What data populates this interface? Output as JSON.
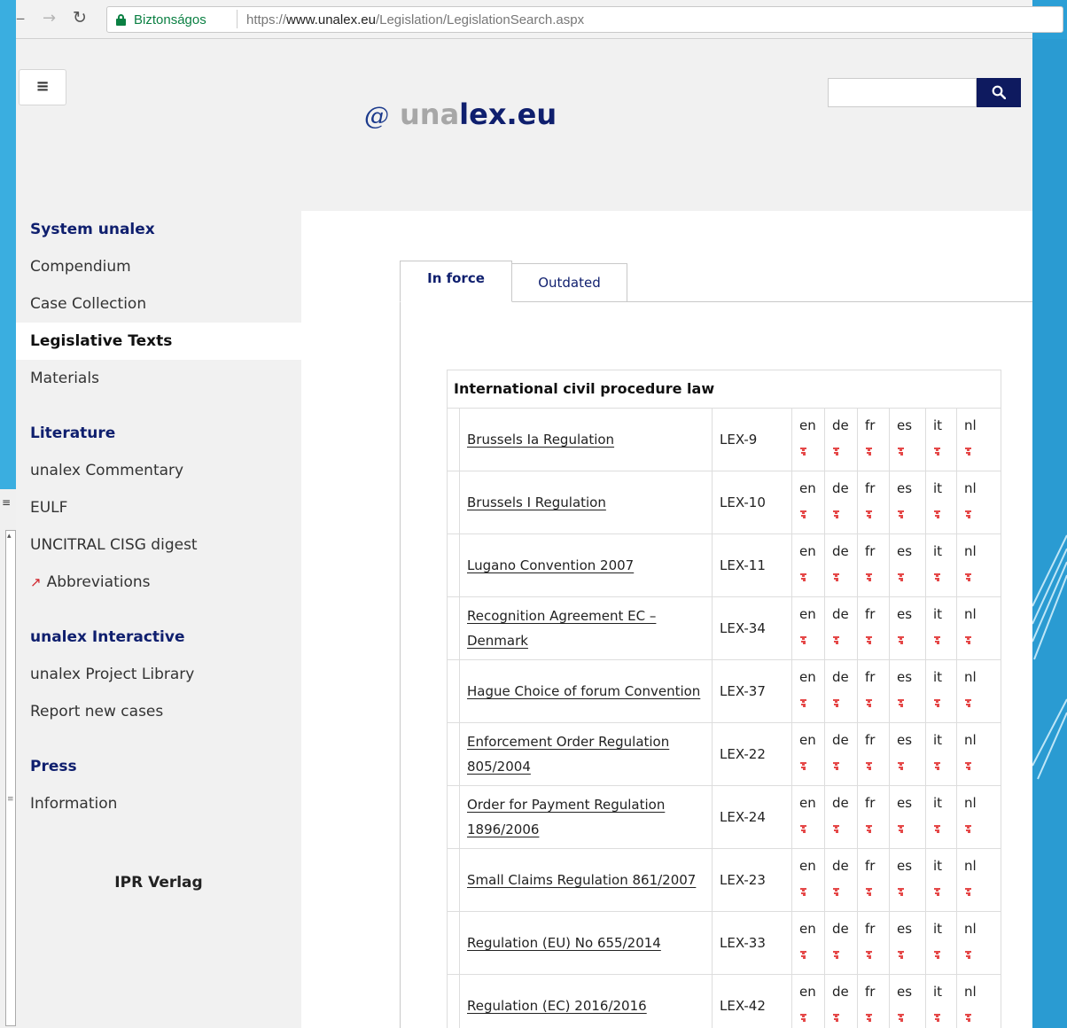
{
  "browser": {
    "secure_label": "Biztonságos",
    "url_scheme": "https://",
    "url_host": "www.unalex.eu",
    "url_path": "/Legislation/LegislationSearch.aspx"
  },
  "header": {
    "menu_icon": "≡",
    "logo_at": "@",
    "logo_una": "una",
    "logo_lex": "lex.eu",
    "search_placeholder": ""
  },
  "sidebar": {
    "items": [
      {
        "label": "System unalex",
        "kind": "head"
      },
      {
        "label": "Compendium"
      },
      {
        "label": "Case Collection"
      },
      {
        "label": "Legislative Texts",
        "kind": "active"
      },
      {
        "label": "Materials"
      },
      {
        "label": "Literature",
        "kind": "head"
      },
      {
        "label": "unalex Commentary"
      },
      {
        "label": "EULF"
      },
      {
        "label": "UNCITRAL CISG digest"
      },
      {
        "label": "Abbreviations",
        "external_icon": "↗"
      },
      {
        "label": "unalex Interactive",
        "kind": "head"
      },
      {
        "label": "unalex Project Library"
      },
      {
        "label": "Report new cases"
      },
      {
        "label": "Press",
        "kind": "head"
      },
      {
        "label": "Information"
      }
    ],
    "footer": "IPR Verlag"
  },
  "tabs": {
    "in_force": "In force",
    "outdated": "Outdated"
  },
  "table": {
    "caption": "International civil procedure law",
    "languages": [
      "en",
      "de",
      "fr",
      "es",
      "it",
      "nl"
    ],
    "rows": [
      {
        "name": "Brussels Ia Regulation",
        "code": "LEX-9"
      },
      {
        "name": "Brussels I Regulation",
        "code": "LEX-10"
      },
      {
        "name": "Lugano Convention 2007",
        "code": "LEX-11"
      },
      {
        "name": "Recognition Agreement EC – Denmark",
        "code": "LEX-34"
      },
      {
        "name": "Hague Choice of forum Convention",
        "code": "LEX-37"
      },
      {
        "name": "Enforcement Order Regulation 805/2004",
        "code": "LEX-22"
      },
      {
        "name": "Order for Payment Regulation 1896/2006",
        "code": "LEX-24"
      },
      {
        "name": "Small Claims Regulation 861/2007",
        "code": "LEX-23"
      },
      {
        "name": "Regulation (EU) No 655/2014",
        "code": "LEX-33"
      },
      {
        "name": "Regulation (EC) 2016/2016",
        "code": "LEX-42"
      }
    ]
  },
  "colors": {
    "brand_navy": "#0f1f6e",
    "secure_green": "#0b8043",
    "pdf_red": "#e54848"
  },
  "icons": {
    "pdf": "pdf-icon",
    "search": "search-icon",
    "lock": "lock-icon"
  }
}
